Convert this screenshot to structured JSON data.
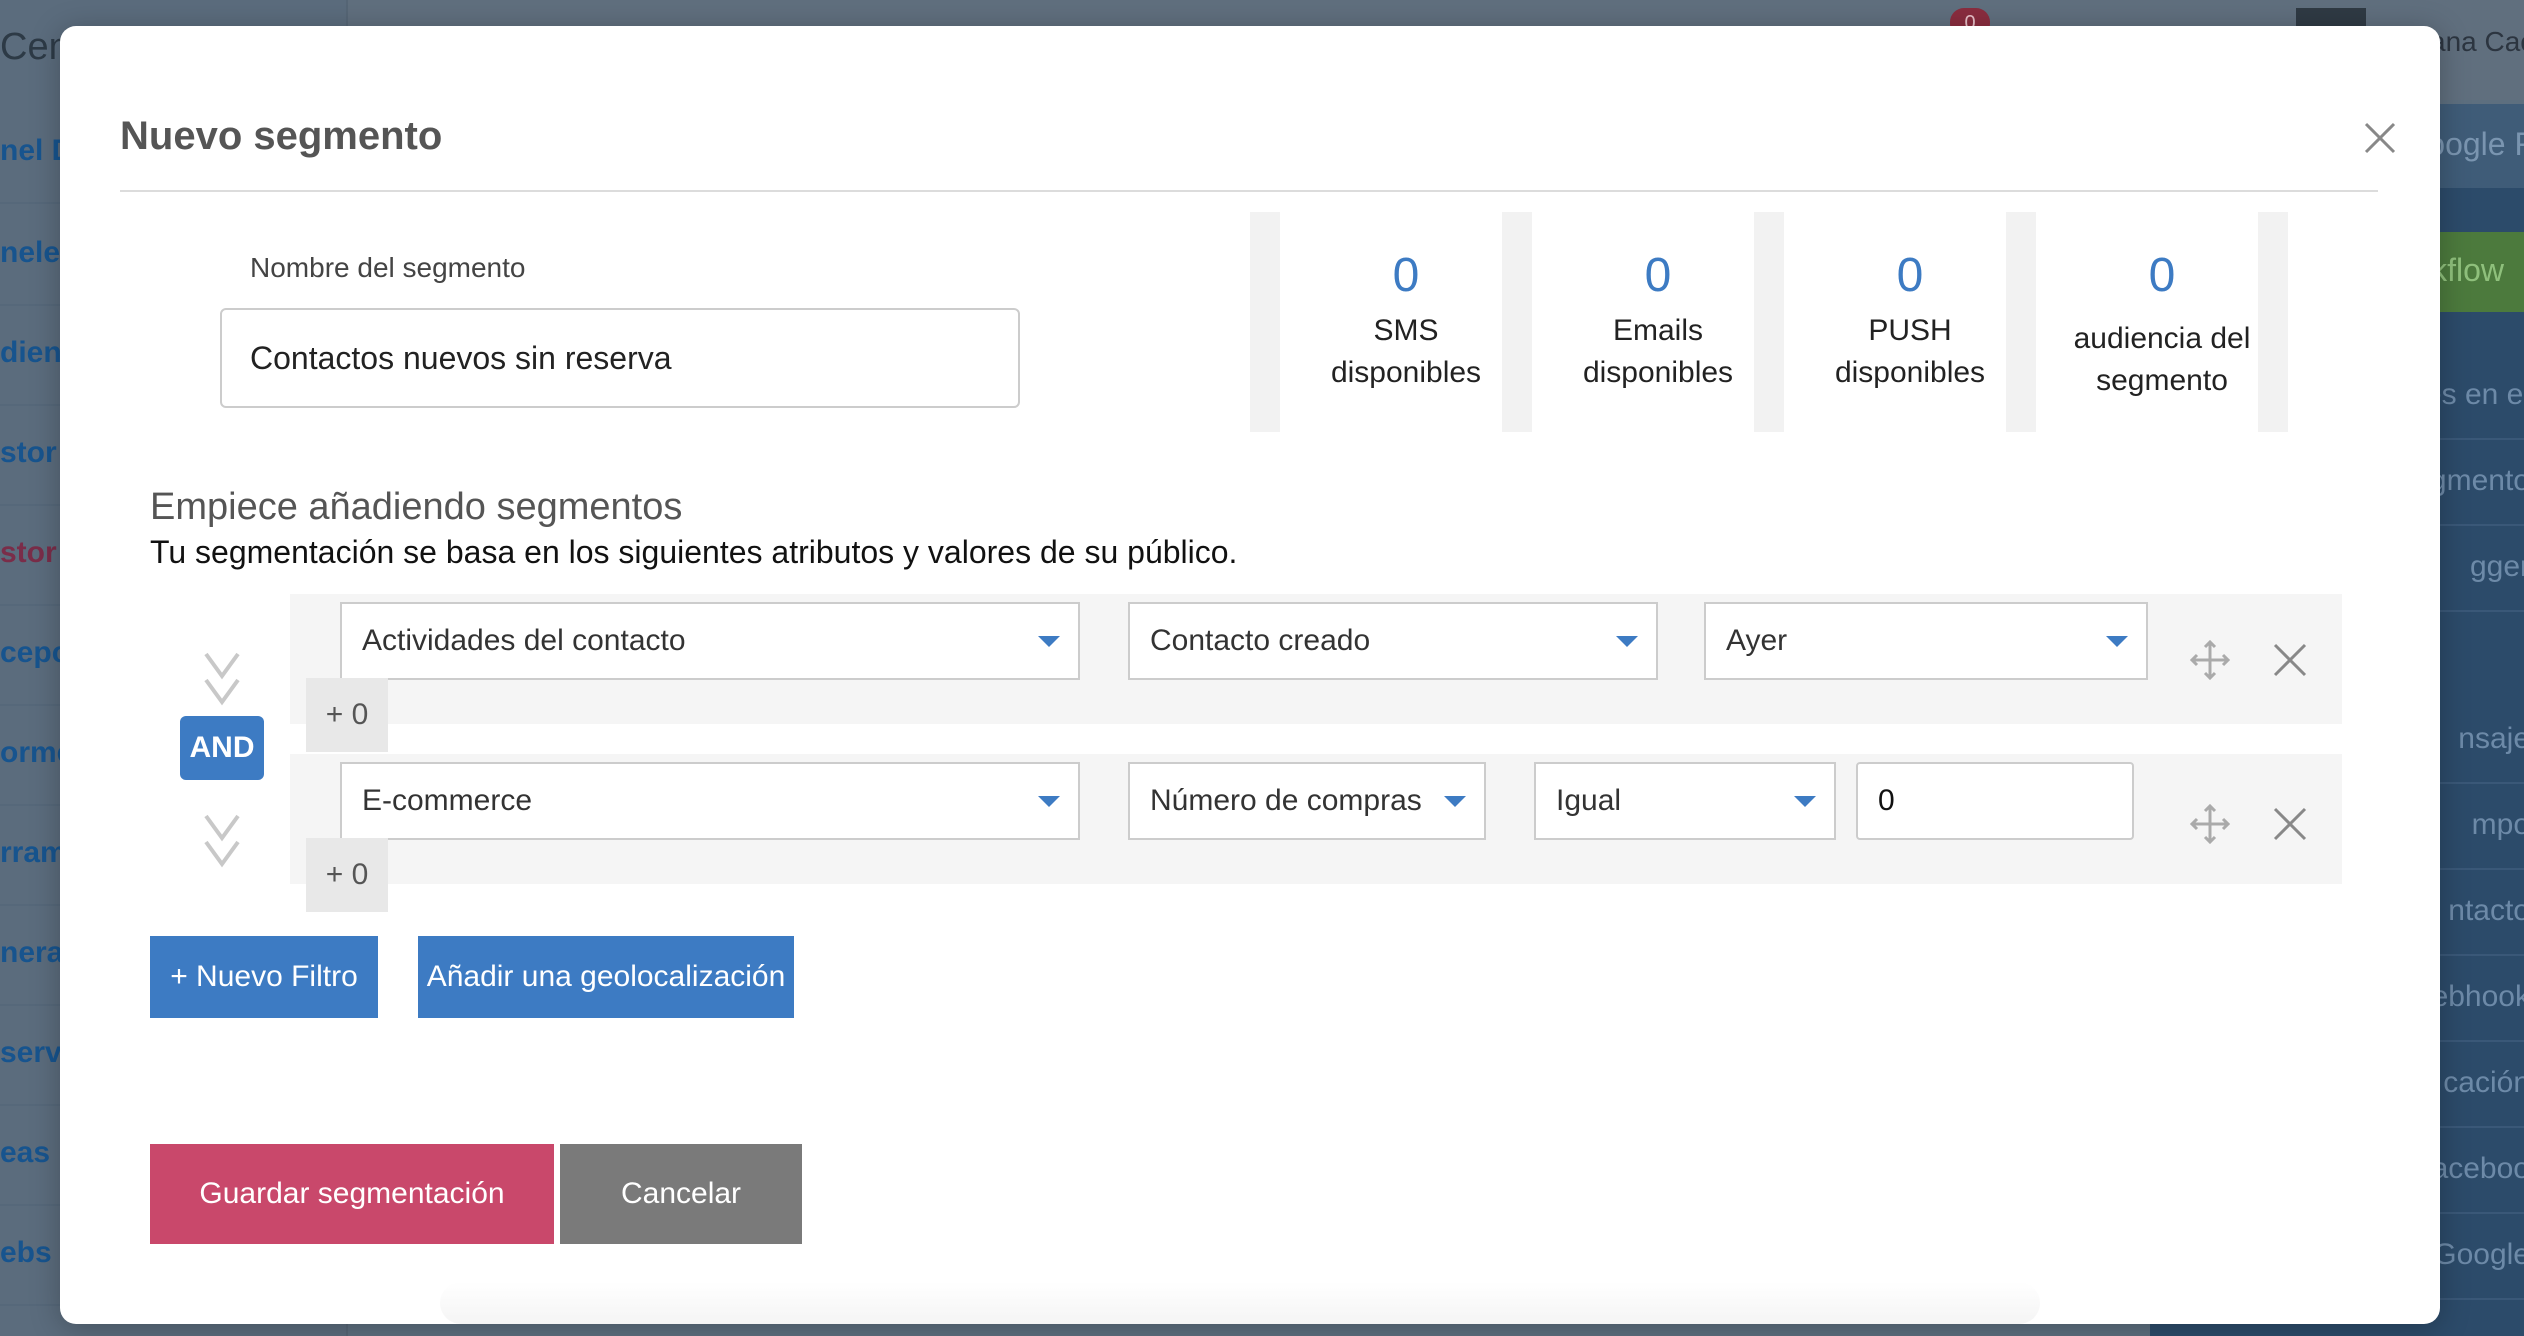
{
  "background": {
    "logo_text": "Cen",
    "sidebar_items": [
      "nel D",
      "neles\nrsona",
      "dien",
      "stor",
      "stor",
      "cepc",
      "orme",
      "rram",
      "nera",
      "serva",
      "eas",
      "ebs y"
    ],
    "notification_count": "0",
    "user_name": "ana Cace",
    "right_panel_items": [
      "oogle F",
      "kflow",
      "es en el",
      "gmento",
      "gger",
      "nsaje",
      "mpo",
      "ntacto",
      "ebhook",
      "cación",
      "aceboo",
      "Google"
    ]
  },
  "modal": {
    "title": "Nuevo segmento",
    "name_label": "Nombre del segmento",
    "name_value": "Contactos nuevos sin reserva",
    "stats": [
      {
        "value": "0",
        "label": "SMS\ndisponibles"
      },
      {
        "value": "0",
        "label": "Emails\ndisponibles"
      },
      {
        "value": "0",
        "label": "PUSH\ndisponibles"
      },
      {
        "value": "0",
        "label": "audiencia del\nsegmento"
      }
    ],
    "section_title": "Empiece añadiendo segmentos",
    "section_subtitle": "Tu segmentación se basa en los siguientes atributos y valores de su público.",
    "operator": "AND",
    "filters": [
      {
        "field": "Actividades del contacto",
        "attribute": "Contacto creado",
        "value": "Ayer",
        "extra": "+ 0"
      },
      {
        "field": "E-commerce",
        "attribute": "Número de compras",
        "comparator": "Igual",
        "value": "0",
        "extra": "+ 0"
      }
    ],
    "buttons": {
      "new_filter": "+ Nuevo Filtro",
      "add_geo": "Añadir una geolocalización",
      "save": "Guardar segmentación",
      "cancel": "Cancelar"
    }
  },
  "colors": {
    "accent": "#3d7bc3",
    "save": "#c9486b",
    "cancel": "#7a7a7a"
  }
}
